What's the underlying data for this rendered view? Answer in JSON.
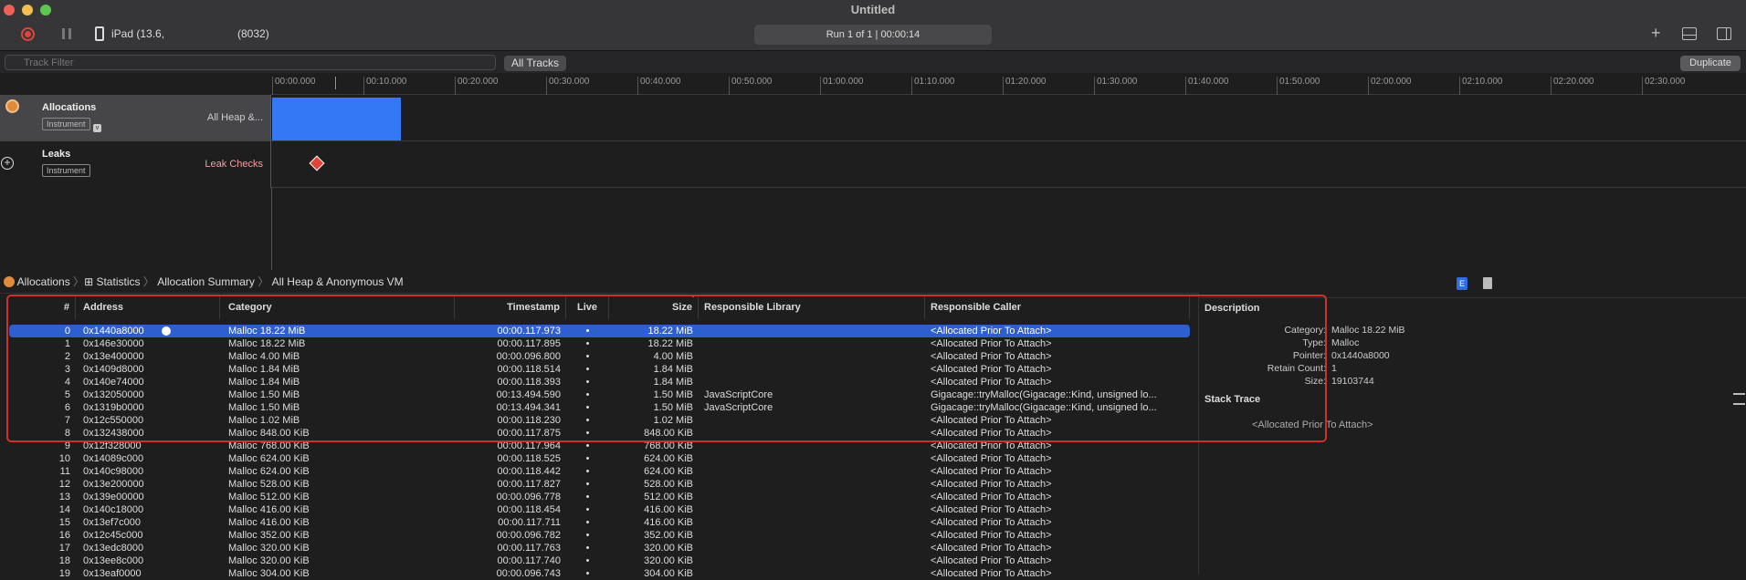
{
  "window": {
    "title": "Untitled"
  },
  "toolbar": {
    "device": "iPad (13.6,",
    "process": "(8032)",
    "run_status": "Run 1 of 1  |  00:00:14",
    "add_icon": "plus-icon"
  },
  "filter": {
    "placeholder": "Track Filter",
    "all_tracks": "All Tracks",
    "duplicate": "Duplicate"
  },
  "ruler": {
    "ticks": [
      "00:00.000",
      "00:10.000",
      "00:20.000",
      "00:30.000",
      "00:40.000",
      "00:50.000",
      "01:00.000",
      "01:10.000",
      "01:20.000",
      "01:30.000",
      "01:40.000",
      "01:50.000",
      "02:00.000",
      "02:10.000",
      "02:20.000",
      "02:30.000"
    ]
  },
  "tracks": [
    {
      "name": "Allocations",
      "badge": "Instrument",
      "sub": "All Heap &..."
    },
    {
      "name": "Leaks",
      "badge": "Instrument",
      "sub": "Leak Checks"
    }
  ],
  "breadcrumb": [
    "Allocations",
    "Statistics",
    "Allocation Summary",
    "All Heap & Anonymous VM"
  ],
  "table": {
    "columns": [
      "#",
      "Address",
      "Category",
      "Timestamp",
      "Live",
      "Size",
      "Responsible Library",
      "Responsible Caller"
    ],
    "rows": [
      [
        "0",
        "0x1440a8000",
        "Malloc 18.22 MiB",
        "00:00.117.973",
        "•",
        "18.22 MiB",
        "",
        "<Allocated Prior To Attach>"
      ],
      [
        "1",
        "0x146e30000",
        "Malloc 18.22 MiB",
        "00:00.117.895",
        "•",
        "18.22 MiB",
        "",
        "<Allocated Prior To Attach>"
      ],
      [
        "2",
        "0x13e400000",
        "Malloc 4.00 MiB",
        "00:00.096.800",
        "•",
        "4.00 MiB",
        "",
        "<Allocated Prior To Attach>"
      ],
      [
        "3",
        "0x1409d8000",
        "Malloc 1.84 MiB",
        "00:00.118.514",
        "•",
        "1.84 MiB",
        "",
        "<Allocated Prior To Attach>"
      ],
      [
        "4",
        "0x140e74000",
        "Malloc 1.84 MiB",
        "00:00.118.393",
        "•",
        "1.84 MiB",
        "",
        "<Allocated Prior To Attach>"
      ],
      [
        "5",
        "0x132050000",
        "Malloc 1.50 MiB",
        "00:13.494.590",
        "•",
        "1.50 MiB",
        "JavaScriptCore",
        "Gigacage::tryMalloc(Gigacage::Kind, unsigned lo..."
      ],
      [
        "6",
        "0x1319b0000",
        "Malloc 1.50 MiB",
        "00:13.494.341",
        "•",
        "1.50 MiB",
        "JavaScriptCore",
        "Gigacage::tryMalloc(Gigacage::Kind, unsigned lo..."
      ],
      [
        "7",
        "0x12c550000",
        "Malloc 1.02 MiB",
        "00:00.118.230",
        "•",
        "1.02 MiB",
        "",
        "<Allocated Prior To Attach>"
      ],
      [
        "8",
        "0x132438000",
        "Malloc 848.00 KiB",
        "00:00.117.875",
        "•",
        "848.00 KiB",
        "",
        "<Allocated Prior To Attach>"
      ],
      [
        "9",
        "0x12f328000",
        "Malloc 768.00 KiB",
        "00:00.117.964",
        "•",
        "768.00 KiB",
        "",
        "<Allocated Prior To Attach>"
      ],
      [
        "10",
        "0x14089c000",
        "Malloc 624.00 KiB",
        "00:00.118.525",
        "•",
        "624.00 KiB",
        "",
        "<Allocated Prior To Attach>"
      ],
      [
        "11",
        "0x140c98000",
        "Malloc 624.00 KiB",
        "00:00.118.442",
        "•",
        "624.00 KiB",
        "",
        "<Allocated Prior To Attach>"
      ],
      [
        "12",
        "0x13e200000",
        "Malloc 528.00 KiB",
        "00:00.117.827",
        "•",
        "528.00 KiB",
        "",
        "<Allocated Prior To Attach>"
      ],
      [
        "13",
        "0x139e00000",
        "Malloc 512.00 KiB",
        "00:00.096.778",
        "•",
        "512.00 KiB",
        "",
        "<Allocated Prior To Attach>"
      ],
      [
        "14",
        "0x140c18000",
        "Malloc 416.00 KiB",
        "00:00.118.454",
        "•",
        "416.00 KiB",
        "",
        "<Allocated Prior To Attach>"
      ],
      [
        "15",
        "0x13ef7c000",
        "Malloc 416.00 KiB",
        "00:00.117.711",
        "•",
        "416.00 KiB",
        "",
        "<Allocated Prior To Attach>"
      ],
      [
        "16",
        "0x12c45c000",
        "Malloc 352.00 KiB",
        "00:00.096.782",
        "•",
        "352.00 KiB",
        "",
        "<Allocated Prior To Attach>"
      ],
      [
        "17",
        "0x13edc8000",
        "Malloc 320.00 KiB",
        "00:00.117.763",
        "•",
        "320.00 KiB",
        "",
        "<Allocated Prior To Attach>"
      ],
      [
        "18",
        "0x13ee8c000",
        "Malloc 320.00 KiB",
        "00:00.117.740",
        "•",
        "320.00 KiB",
        "",
        "<Allocated Prior To Attach>"
      ],
      [
        "19",
        "0x13eaf0000",
        "Malloc 304.00 KiB",
        "00:00.096.743",
        "•",
        "304.00 KiB",
        "",
        "<Allocated Prior To Attach>"
      ]
    ],
    "selected_row": 0,
    "sort_column": "Size"
  },
  "detail": {
    "description_title": "Description",
    "fields": [
      [
        "Category:",
        "Malloc 18.22 MiB"
      ],
      [
        "Type:",
        "Malloc"
      ],
      [
        "Pointer:",
        "0x1440a8000"
      ],
      [
        "Retain Count:",
        "1"
      ],
      [
        "Size:",
        "19103744"
      ]
    ],
    "stack_title": "Stack Trace",
    "stack_text": "<Allocated Prior To Attach>"
  },
  "colors": {
    "accent": "#2d5fcf",
    "track_fill": "#3478f6",
    "highlight_box": "#d0302a",
    "record": "#e0453a"
  }
}
